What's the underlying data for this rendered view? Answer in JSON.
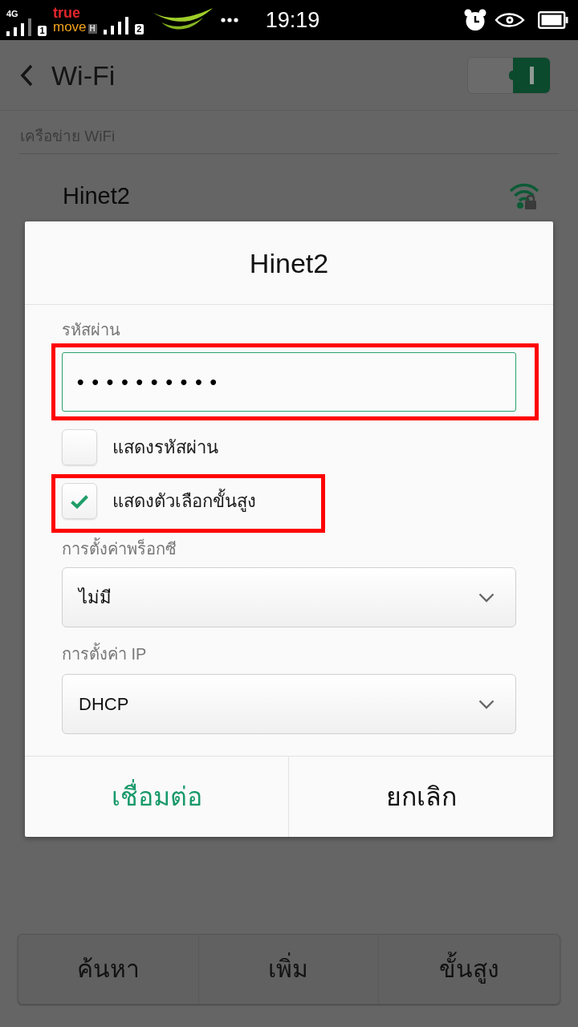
{
  "status_bar": {
    "sim_1": {
      "network": "4G",
      "slot": "1"
    },
    "carrier_logo": {
      "line_1": "true",
      "line_2": "move",
      "network_type": "H"
    },
    "sim_2": {
      "slot": "2"
    },
    "time": "19:19"
  },
  "header": {
    "title": "Wi-Fi",
    "wifi_switch": {
      "on": true
    }
  },
  "section_label": "เครือข่าย WiFi",
  "network": {
    "name": "Hinet2"
  },
  "dialog": {
    "title": "Hinet2",
    "password": {
      "label": "รหัสผ่าน",
      "value": "••••••••••",
      "focused": true,
      "highlighted": true
    },
    "checkboxes": [
      {
        "label": "แสดงรหัสผ่าน",
        "checked": false,
        "highlighted": false
      },
      {
        "label": "แสดงตัวเลือกขั้นสูง",
        "checked": true,
        "highlighted": true
      }
    ],
    "selects": [
      {
        "label": "การตั้งค่าพร็อกซี",
        "value": "ไม่มี"
      },
      {
        "label": "การตั้งค่า IP",
        "value": "DHCP"
      }
    ],
    "buttons": [
      {
        "label": "เชื่อมต่อ",
        "primary": true
      },
      {
        "label": "ยกเลิก",
        "primary": false
      }
    ]
  },
  "bottom_bar": {
    "buttons": [
      "ค้นหา",
      "เพิ่ม",
      "ขั้นสูง"
    ]
  }
}
